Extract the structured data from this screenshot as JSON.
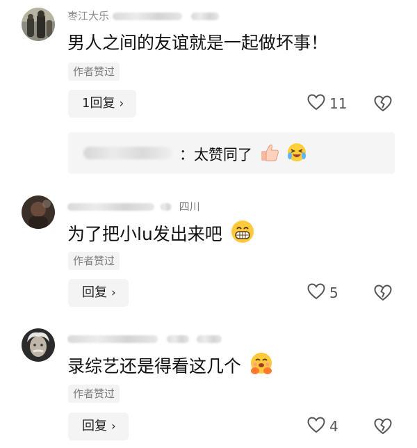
{
  "comments": [
    {
      "username_visible": "枣江大乐",
      "text": "男人之间的友谊就是一起做坏事！",
      "liked_badge": "作者赞过",
      "reply_label": "1回复",
      "like_count": "11",
      "sub_reply": {
        "text": "：太赞同了",
        "emojis": [
          "thumbs-up-emoji",
          "laughing-crying-emoji"
        ]
      },
      "avatar": "avatar-people-photo"
    },
    {
      "username_visible": "四川",
      "text": "为了把小lu发出来吧",
      "liked_badge": "作者赞过",
      "reply_label": "回复",
      "like_count": "5",
      "emoji": "grinning-emoji",
      "avatar": "avatar-dark-photo"
    },
    {
      "username_visible": "",
      "text": "录综艺还是得看这几个",
      "liked_badge": "作者赞过",
      "reply_label": "回复",
      "like_count": "4",
      "emoji": "hugging-emoji",
      "avatar": "avatar-einstein-photo"
    }
  ],
  "icons": {
    "like": "heart-outline-icon",
    "dislike": "broken-heart-icon",
    "chevron": "chevron-right-icon"
  },
  "colors": {
    "meta_text": "#8a8a8a",
    "badge_bg": "#f3f3f3",
    "button_bg": "#f4f4f4"
  }
}
